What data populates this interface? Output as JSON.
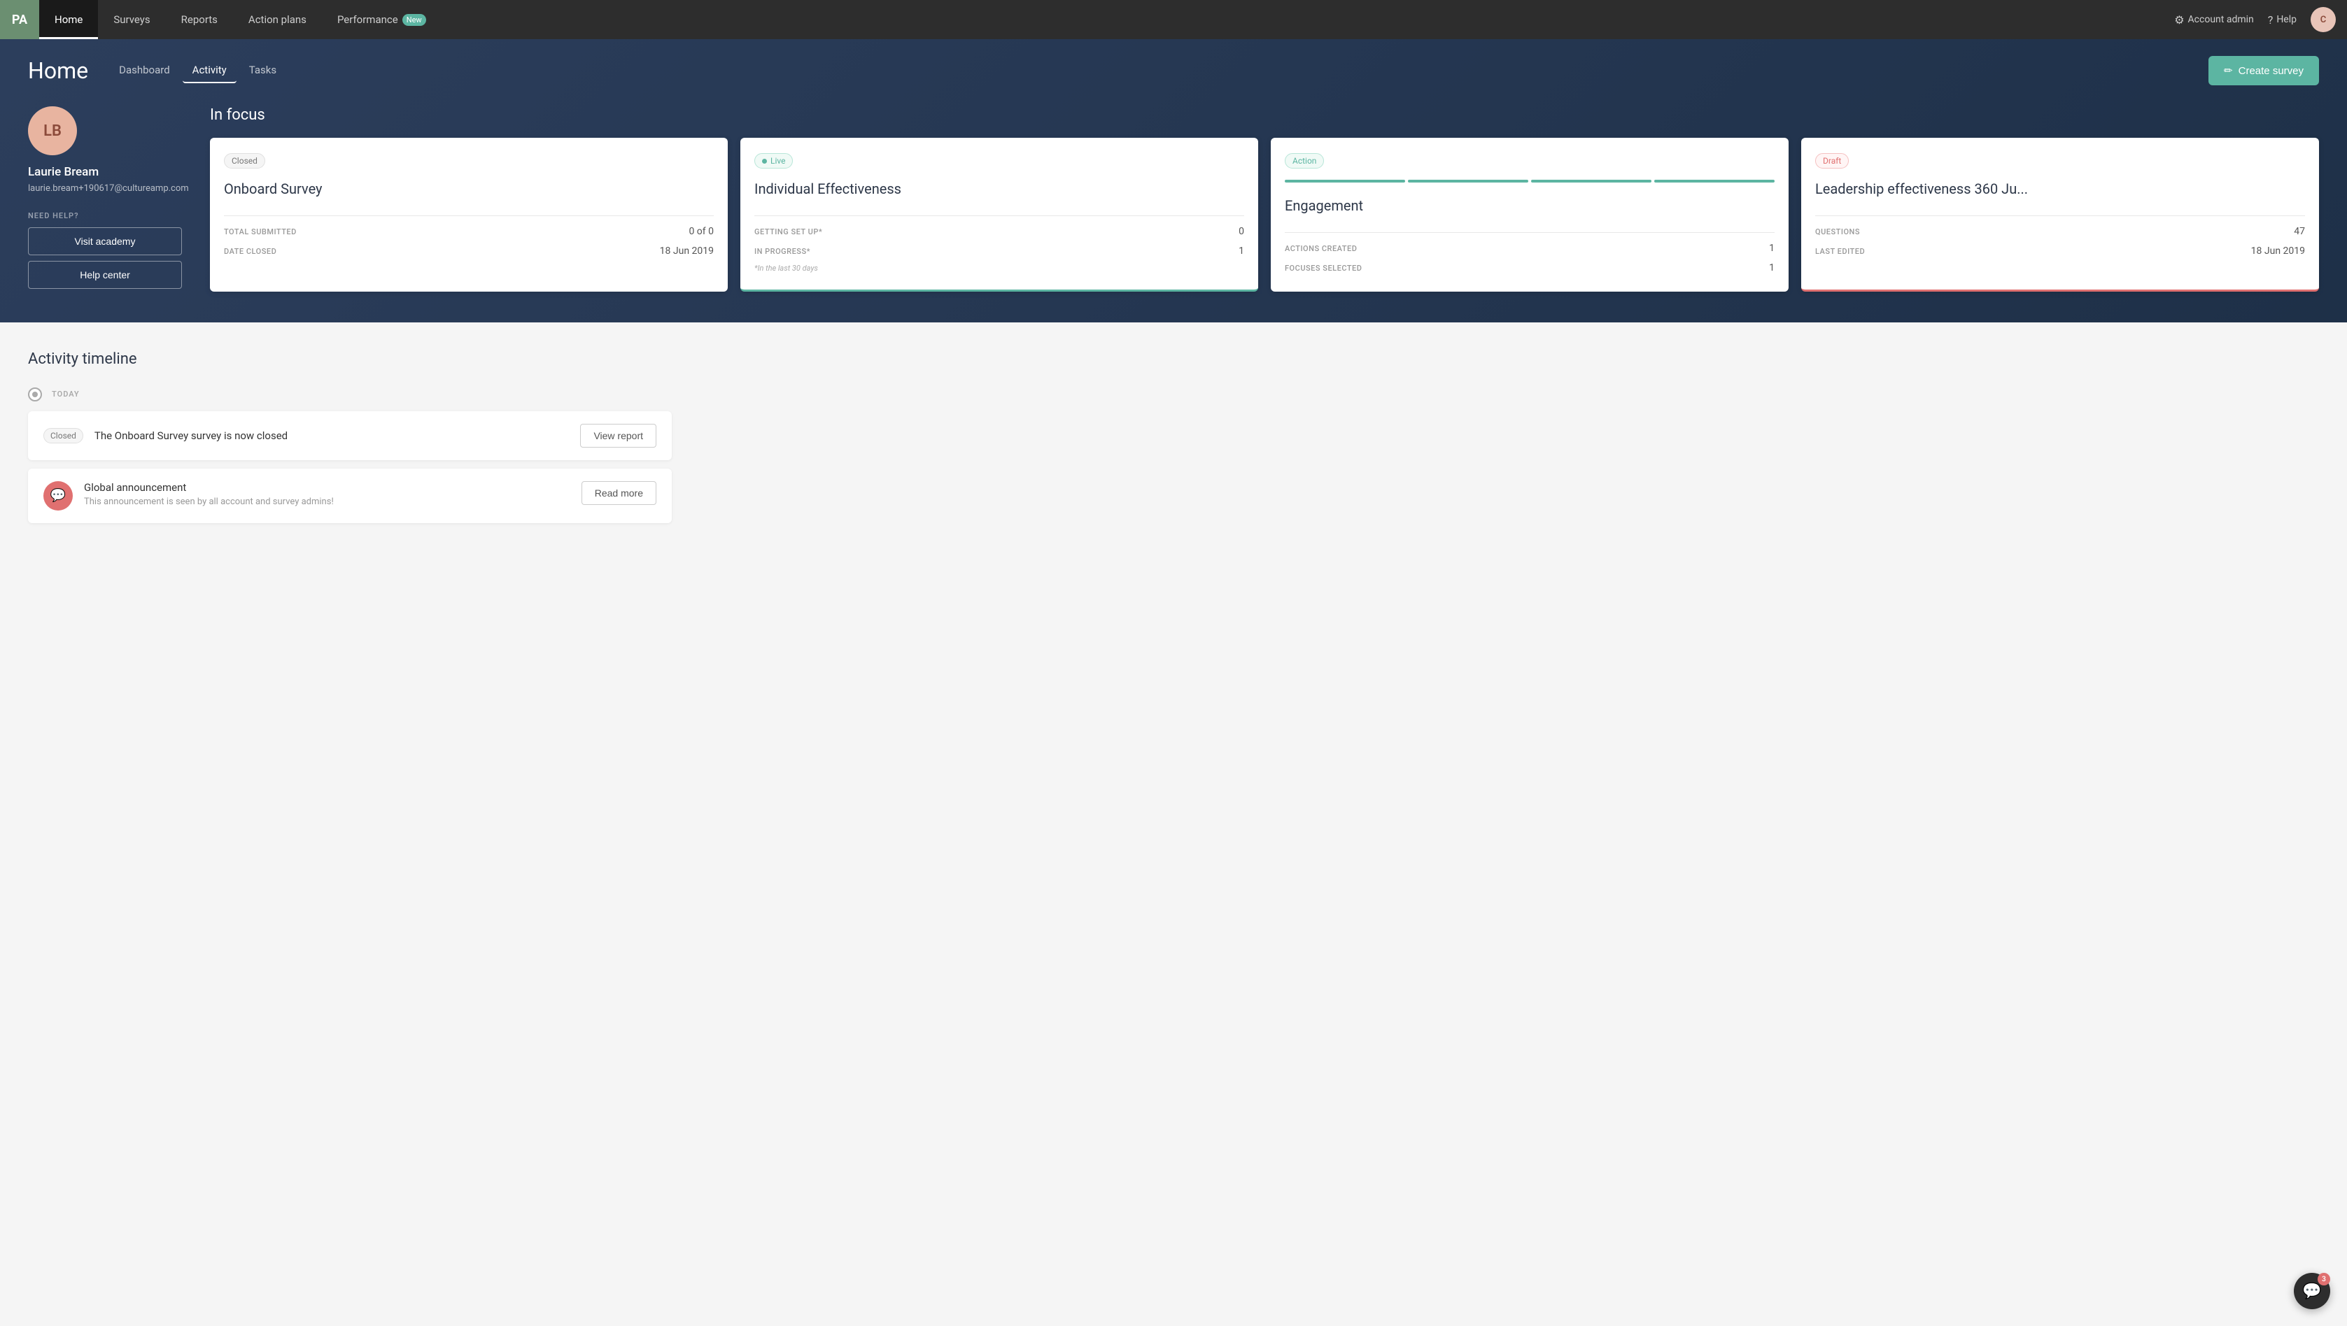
{
  "nav": {
    "logo": "PA",
    "items": [
      {
        "label": "Home",
        "active": true
      },
      {
        "label": "Surveys",
        "active": false
      },
      {
        "label": "Reports",
        "active": false
      },
      {
        "label": "Action plans",
        "active": false
      },
      {
        "label": "Performance",
        "active": false,
        "badge": "New"
      }
    ],
    "right": {
      "account_admin": "Account admin",
      "help": "Help",
      "avatar_initials": "C"
    }
  },
  "header": {
    "page_title": "Home",
    "tabs": [
      {
        "label": "Dashboard",
        "active": false
      },
      {
        "label": "Activity",
        "active": true
      },
      {
        "label": "Tasks",
        "active": false
      }
    ],
    "create_survey_label": "Create survey"
  },
  "profile": {
    "initials": "LB",
    "name": "Laurie Bream",
    "email_line1": "laurie.bream+190617",
    "email_line2": "@cultureamp.com",
    "need_help_label": "NEED HELP?",
    "visit_academy_label": "Visit academy",
    "help_center_label": "Help center"
  },
  "in_focus": {
    "section_title": "In focus",
    "cards": [
      {
        "badge": "Closed",
        "badge_type": "closed",
        "title": "Onboard Survey",
        "stats": [
          {
            "label": "TOTAL SUBMITTED",
            "value": "0 of 0"
          },
          {
            "label": "DATE CLOSED",
            "value": "18 Jun 2019"
          }
        ]
      },
      {
        "badge": "Live",
        "badge_type": "live",
        "title": "Individual Effectiveness",
        "stats": [
          {
            "label": "GETTING SET UP*",
            "value": "0"
          },
          {
            "label": "IN PROGRESS*",
            "value": "1"
          }
        ],
        "footnote": "*In the last 30 days"
      },
      {
        "badge": "Action",
        "badge_type": "action",
        "title": "Engagement",
        "stats": [
          {
            "label": "ACTIONS CREATED",
            "value": "1"
          },
          {
            "label": "FOCUSES SELECTED",
            "value": "1"
          }
        ],
        "progress_bars": 4
      },
      {
        "badge": "Draft",
        "badge_type": "draft",
        "title": "Leadership effectiveness 360 Ju...",
        "stats": [
          {
            "label": "QUESTIONS",
            "value": "47"
          },
          {
            "label": "LAST EDITED",
            "value": "18 Jun 2019"
          }
        ]
      }
    ]
  },
  "activity_timeline": {
    "section_title": "Activity timeline",
    "day_label": "TODAY",
    "items": [
      {
        "type": "survey_closed",
        "badge_text": "Closed",
        "badge_type": "closed",
        "text": "The Onboard Survey survey is now closed",
        "action_label": "View report"
      },
      {
        "type": "announcement",
        "icon": "💬",
        "title": "Global announcement",
        "subtitle": "This announcement is seen by all account and survey admins!",
        "action_label": "Read more"
      }
    ]
  },
  "chat": {
    "badge_count": "3"
  }
}
